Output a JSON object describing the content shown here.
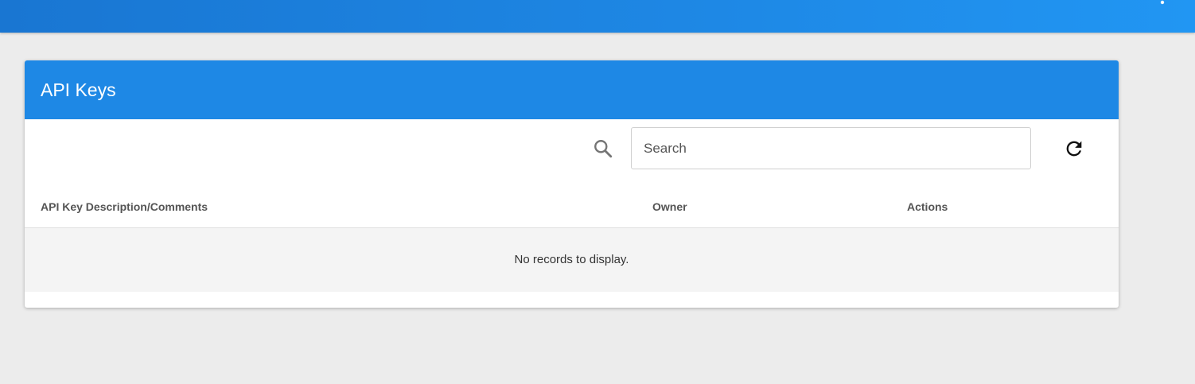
{
  "topbar": {
    "menu_icon": "more-vert-icon"
  },
  "card": {
    "title": "API Keys",
    "header_color": "#1e88e5"
  },
  "toolbar": {
    "search_icon": "search-icon",
    "search_placeholder": "Search",
    "search_value": "",
    "refresh_icon": "refresh-icon"
  },
  "table": {
    "columns": [
      "API Key Description/Comments",
      "Owner",
      "Actions"
    ],
    "rows": [],
    "empty_message": "No records to display."
  }
}
